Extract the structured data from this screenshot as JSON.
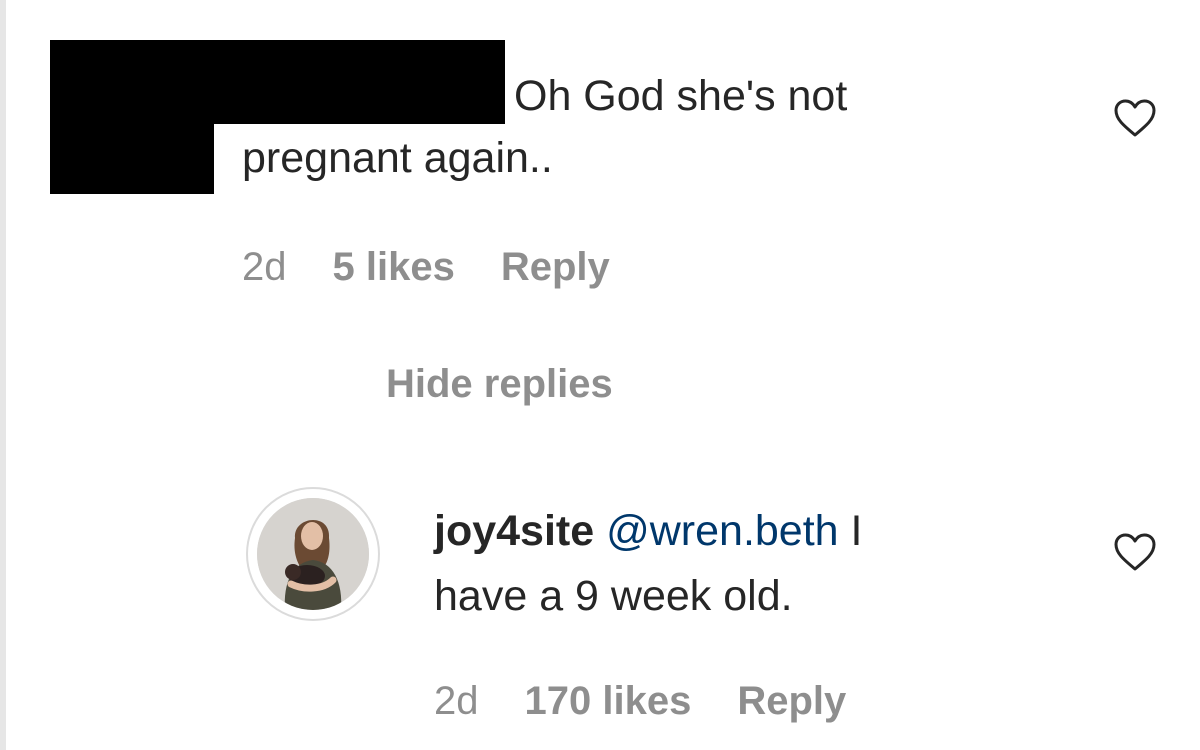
{
  "comment": {
    "text_line1": "Oh God she's not",
    "text_line2": "pregnant again..",
    "time": "2d",
    "likes": "5 likes",
    "reply_label": "Reply",
    "like_icon": "heart-outline-icon"
  },
  "hide_replies_label": "Hide replies",
  "reply": {
    "username": "joy4site",
    "mention": "@wren.beth",
    "text_after_mention": "I",
    "text_line2": "have a 9 week old.",
    "time": "2d",
    "likes": "170 likes",
    "reply_label": "Reply",
    "like_icon": "heart-outline-icon"
  },
  "colors": {
    "text": "#262626",
    "secondary": "#8e8e8e",
    "mention": "#00376b",
    "redaction": "#000000"
  }
}
